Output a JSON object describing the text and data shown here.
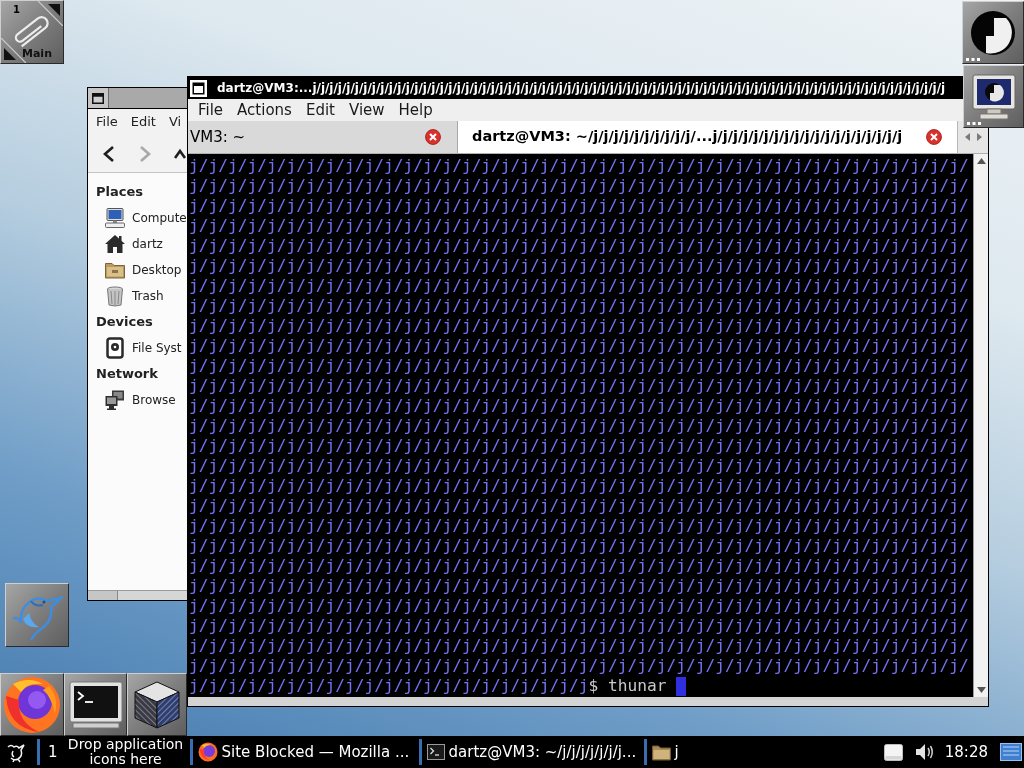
{
  "workspace_clip": {
    "number": "1",
    "name": "Main"
  },
  "file_manager": {
    "menu": [
      "File",
      "Edit",
      "Vi"
    ],
    "navigation": [
      {
        "kind": "back",
        "disabled": false
      },
      {
        "kind": "forward",
        "disabled": true
      },
      {
        "kind": "up",
        "disabled": false
      }
    ],
    "sidebar": [
      {
        "heading": "Places",
        "items": [
          {
            "kind": "computer",
            "label": "Compute"
          },
          {
            "kind": "home",
            "label": "dartz"
          },
          {
            "kind": "desktop",
            "label": "Desktop"
          },
          {
            "kind": "trash",
            "label": "Trash"
          }
        ]
      },
      {
        "heading": "Devices",
        "items": [
          {
            "kind": "drive",
            "label": "File Syst"
          }
        ]
      },
      {
        "heading": "Network",
        "items": [
          {
            "kind": "network",
            "label": "Browse"
          }
        ]
      }
    ]
  },
  "terminal": {
    "title": "dartz@VM3:...j/j/j/j/j/j/j/j/j/j/j/j/j/j/j/j/j/j/j/j/j/j/j/j/j/j/j/j/j/j/j/j/j/j/j/j/j/j/j/j/j/j/j/j/j/j/j/j/j/j/j/j/j/j/j/j/j/j/j/j/j/j/j/j/j/j/j/j/j/j/j/j/j/j/j",
    "menu": [
      "File",
      "Actions",
      "Edit",
      "View",
      "Help"
    ],
    "tabs": [
      {
        "label": "VM3: ~",
        "selected": false
      },
      {
        "label": "dartz@VM3: ~/j/j/j/j/j/j/j/j/j/j/...j/j/j/j/j/j/j/j/j/j/j/j/j/j/j/j/j/j/j",
        "selected": true
      }
    ],
    "lines": [
      "j/j/j/j/j/j/j/j/j/j/j/j/j/j/j/j/j/j/j/j/j/j/j/j/j/j/j/j/j/j/j/j/j/j/j/j/j/j/j/j/",
      "j/j/j/j/j/j/j/j/j/j/j/j/j/j/j/j/j/j/j/j/j/j/j/j/j/j/j/j/j/j/j/j/j/j/j/j/j/j/j/j/",
      "j/j/j/j/j/j/j/j/j/j/j/j/j/j/j/j/j/j/j/j/j/j/j/j/j/j/j/j/j/j/j/j/j/j/j/j/j/j/j/j/",
      "j/j/j/j/j/j/j/j/j/j/j/j/j/j/j/j/j/j/j/j/j/j/j/j/j/j/j/j/j/j/j/j/j/j/j/j/j/j/j/j/",
      "j/j/j/j/j/j/j/j/j/j/j/j/j/j/j/j/j/j/j/j/j/j/j/j/j/j/j/j/j/j/j/j/j/j/j/j/j/j/j/j/",
      "j/j/j/j/j/j/j/j/j/j/j/j/j/j/j/j/j/j/j/j/j/j/j/j/j/j/j/j/j/j/j/j/j/j/j/j/j/j/j/j/",
      "j/j/j/j/j/j/j/j/j/j/j/j/j/j/j/j/j/j/j/j/j/j/j/j/j/j/j/j/j/j/j/j/j/j/j/j/j/j/j/j/",
      "j/j/j/j/j/j/j/j/j/j/j/j/j/j/j/j/j/j/j/j/j/j/j/j/j/j/j/j/j/j/j/j/j/j/j/j/j/j/j/j/",
      "j/j/j/j/j/j/j/j/j/j/j/j/j/j/j/j/j/j/j/j/j/j/j/j/j/j/j/j/j/j/j/j/j/j/j/j/j/j/j/j/",
      "j/j/j/j/j/j/j/j/j/j/j/j/j/j/j/j/j/j/j/j/j/j/j/j/j/j/j/j/j/j/j/j/j/j/j/j/j/j/j/j/",
      "j/j/j/j/j/j/j/j/j/j/j/j/j/j/j/j/j/j/j/j/j/j/j/j/j/j/j/j/j/j/j/j/j/j/j/j/j/j/j/j/",
      "j/j/j/j/j/j/j/j/j/j/j/j/j/j/j/j/j/j/j/j/j/j/j/j/j/j/j/j/j/j/j/j/j/j/j/j/j/j/j/j/",
      "j/j/j/j/j/j/j/j/j/j/j/j/j/j/j/j/j/j/j/j/j/j/j/j/j/j/j/j/j/j/j/j/j/j/j/j/j/j/j/j/",
      "j/j/j/j/j/j/j/j/j/j/j/j/j/j/j/j/j/j/j/j/j/j/j/j/j/j/j/j/j/j/j/j/j/j/j/j/j/j/j/j/",
      "j/j/j/j/j/j/j/j/j/j/j/j/j/j/j/j/j/j/j/j/j/j/j/j/j/j/j/j/j/j/j/j/j/j/j/j/j/j/j/j/",
      "j/j/j/j/j/j/j/j/j/j/j/j/j/j/j/j/j/j/j/j/j/j/j/j/j/j/j/j/j/j/j/j/j/j/j/j/j/j/j/j/",
      "j/j/j/j/j/j/j/j/j/j/j/j/j/j/j/j/j/j/j/j/j/j/j/j/j/j/j/j/j/j/j/j/j/j/j/j/j/j/j/j/",
      "j/j/j/j/j/j/j/j/j/j/j/j/j/j/j/j/j/j/j/j/j/j/j/j/j/j/j/j/j/j/j/j/j/j/j/j/j/j/j/j/",
      "j/j/j/j/j/j/j/j/j/j/j/j/j/j/j/j/j/j/j/j/j/j/j/j/j/j/j/j/j/j/j/j/j/j/j/j/j/j/j/j/",
      "j/j/j/j/j/j/j/j/j/j/j/j/j/j/j/j/j/j/j/j/j/j/j/j/j/j/j/j/j/j/j/j/j/j/j/j/j/j/j/j/",
      "j/j/j/j/j/j/j/j/j/j/j/j/j/j/j/j/j/j/j/j/j/j/j/j/j/j/j/j/j/j/j/j/j/j/j/j/j/j/j/j/",
      "j/j/j/j/j/j/j/j/j/j/j/j/j/j/j/j/j/j/j/j/j/j/j/j/j/j/j/j/j/j/j/j/j/j/j/j/j/j/j/j/",
      "j/j/j/j/j/j/j/j/j/j/j/j/j/j/j/j/j/j/j/j/j/j/j/j/j/j/j/j/j/j/j/j/j/j/j/j/j/j/j/j/",
      "j/j/j/j/j/j/j/j/j/j/j/j/j/j/j/j/j/j/j/j/j/j/j/j/j/j/j/j/j/j/j/j/j/j/j/j/j/j/j/j/",
      "j/j/j/j/j/j/j/j/j/j/j/j/j/j/j/j/j/j/j/j/j/j/j/j/j/j/j/j/j/j/j/j/j/j/j/j/j/j/j/j/",
      "j/j/j/j/j/j/j/j/j/j/j/j/j/j/j/j/j/j/j/j/j/j/j/j/j/j/j/j/j/j/j/j/j/j/j/j/j/j/j/j/"
    ],
    "prompt": {
      "path": "j/j/j/j/j/j/j/j/j/j/j/j/j/j/j/j/j/j/j/j/j",
      "command": "$ thunar"
    }
  },
  "taskbar": {
    "workspace": "1",
    "launcher_hint": "Drop application icons here",
    "windows": [
      {
        "kind": "browser",
        "label": "Site Blocked — Mozilla ..."
      },
      {
        "kind": "terminal",
        "label": "dartz@VM3: ~/j/j/j/j/j/j/j..."
      },
      {
        "kind": "folder",
        "label": "j"
      }
    ],
    "clock": "18:28"
  }
}
